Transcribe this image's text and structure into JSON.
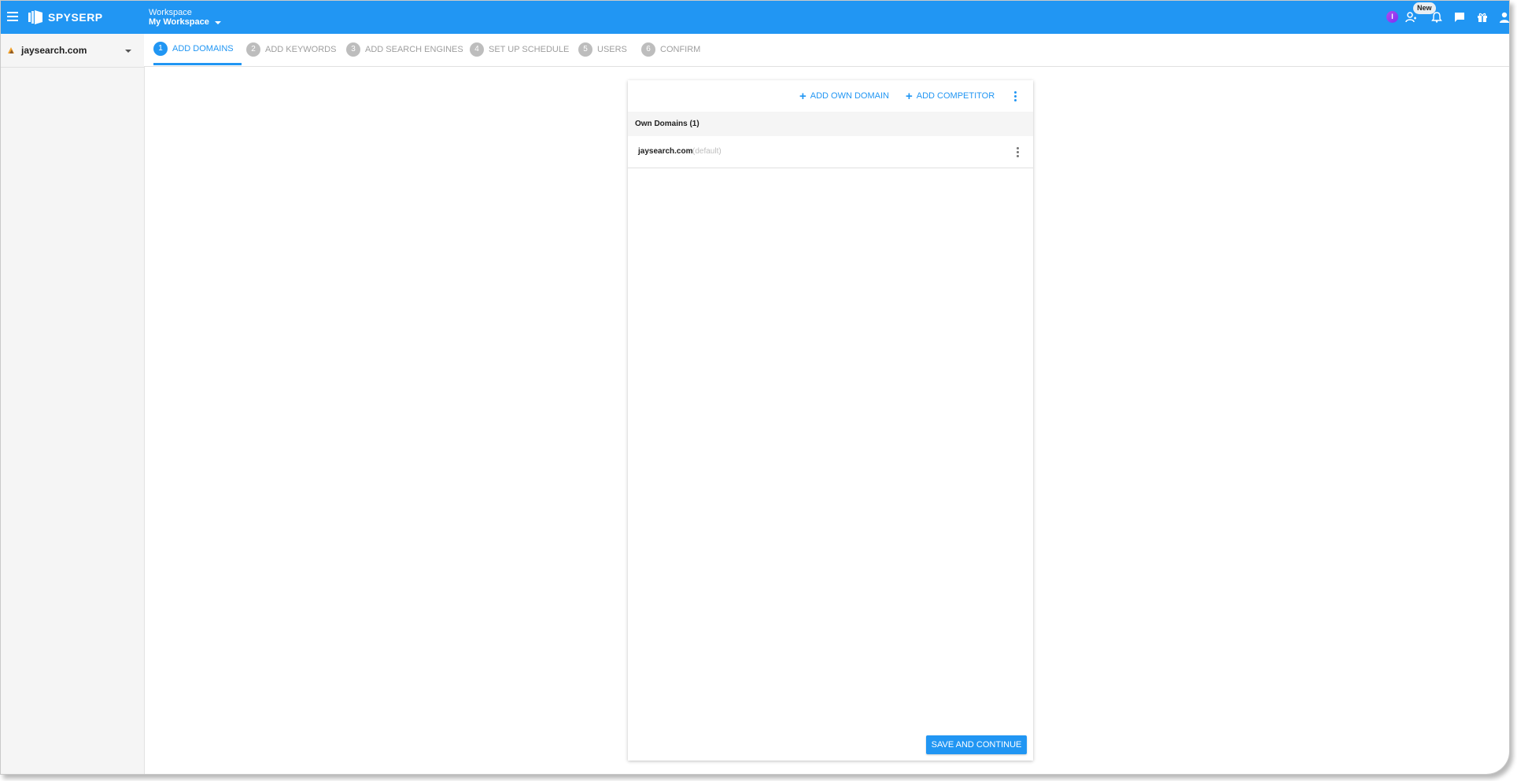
{
  "topbar": {
    "brand": "SPYSERP",
    "workspace_caption": "Workspace",
    "workspace_name": "My Workspace",
    "avatar_initial": "I",
    "new_badge": "New",
    "color": "#2196f3"
  },
  "sidebar": {
    "project_name": "jaysearch.com"
  },
  "steps": [
    {
      "num": "1",
      "label": "ADD DOMAINS",
      "active": true
    },
    {
      "num": "2",
      "label": "ADD KEYWORDS",
      "active": false
    },
    {
      "num": "3",
      "label": "ADD SEARCH ENGINES",
      "active": false
    },
    {
      "num": "4",
      "label": "SET UP SCHEDULE",
      "active": false
    },
    {
      "num": "5",
      "label": "USERS",
      "active": false
    },
    {
      "num": "6",
      "label": "CONFIRM",
      "active": false
    }
  ],
  "card": {
    "add_own_domain": "ADD OWN DOMAIN",
    "add_competitor": "ADD COMPETITOR",
    "section_title": "Own Domains (1)",
    "domains": [
      {
        "name": "jaysearch.com",
        "tag": "(default)"
      }
    ],
    "save_label": "SAVE AND CONTINUE"
  }
}
